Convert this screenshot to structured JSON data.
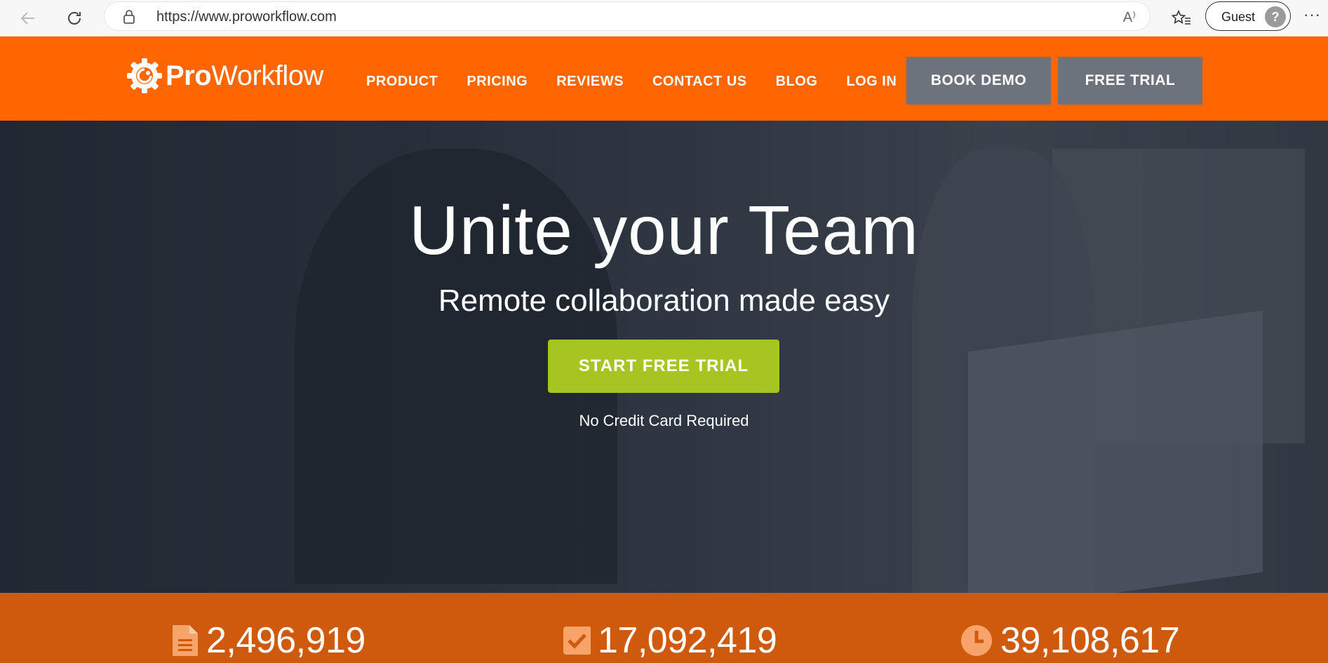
{
  "browser": {
    "url": "https://www.proworkflow.com",
    "profile_label": "Guest",
    "read_aloud_label": "A⁾",
    "more_label": "···"
  },
  "header": {
    "logo_bold": "Pro",
    "logo_rest": "Workflow",
    "nav": [
      "PRODUCT",
      "PRICING",
      "REVIEWS",
      "CONTACT US",
      "BLOG",
      "LOG IN"
    ],
    "book_demo": "BOOK DEMO",
    "free_trial": "FREE TRIAL",
    "brand_color": "#ff6600"
  },
  "hero": {
    "title": "Unite your Team",
    "subtitle": "Remote collaboration made easy",
    "cta": "START FREE TRIAL",
    "cta_color": "#a6c520",
    "note": "No Credit Card Required"
  },
  "stats": [
    {
      "icon": "document-icon",
      "value": "2,496,919"
    },
    {
      "icon": "checkbox-icon",
      "value": "17,092,419"
    },
    {
      "icon": "clock-icon",
      "value": "39,108,617"
    }
  ]
}
